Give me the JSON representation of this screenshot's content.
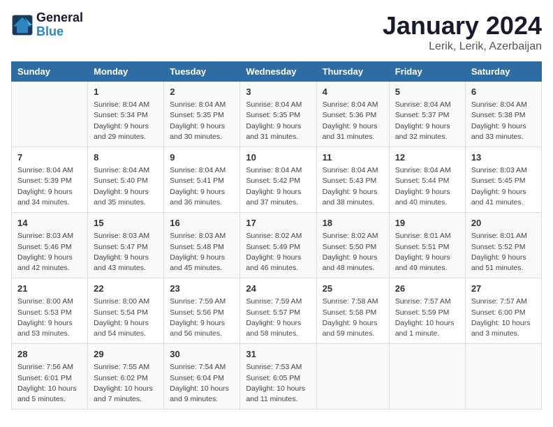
{
  "header": {
    "logo_line1": "General",
    "logo_line2": "Blue",
    "month": "January 2024",
    "location": "Lerik, Lerik, Azerbaijan"
  },
  "days": [
    "Sunday",
    "Monday",
    "Tuesday",
    "Wednesday",
    "Thursday",
    "Friday",
    "Saturday"
  ],
  "weeks": [
    [
      {
        "date": "",
        "text": ""
      },
      {
        "date": "1",
        "text": "Sunrise: 8:04 AM\nSunset: 5:34 PM\nDaylight: 9 hours\nand 29 minutes."
      },
      {
        "date": "2",
        "text": "Sunrise: 8:04 AM\nSunset: 5:35 PM\nDaylight: 9 hours\nand 30 minutes."
      },
      {
        "date": "3",
        "text": "Sunrise: 8:04 AM\nSunset: 5:35 PM\nDaylight: 9 hours\nand 31 minutes."
      },
      {
        "date": "4",
        "text": "Sunrise: 8:04 AM\nSunset: 5:36 PM\nDaylight: 9 hours\nand 31 minutes."
      },
      {
        "date": "5",
        "text": "Sunrise: 8:04 AM\nSunset: 5:37 PM\nDaylight: 9 hours\nand 32 minutes."
      },
      {
        "date": "6",
        "text": "Sunrise: 8:04 AM\nSunset: 5:38 PM\nDaylight: 9 hours\nand 33 minutes."
      }
    ],
    [
      {
        "date": "7",
        "text": "Sunrise: 8:04 AM\nSunset: 5:39 PM\nDaylight: 9 hours\nand 34 minutes."
      },
      {
        "date": "8",
        "text": "Sunrise: 8:04 AM\nSunset: 5:40 PM\nDaylight: 9 hours\nand 35 minutes."
      },
      {
        "date": "9",
        "text": "Sunrise: 8:04 AM\nSunset: 5:41 PM\nDaylight: 9 hours\nand 36 minutes."
      },
      {
        "date": "10",
        "text": "Sunrise: 8:04 AM\nSunset: 5:42 PM\nDaylight: 9 hours\nand 37 minutes."
      },
      {
        "date": "11",
        "text": "Sunrise: 8:04 AM\nSunset: 5:43 PM\nDaylight: 9 hours\nand 38 minutes."
      },
      {
        "date": "12",
        "text": "Sunrise: 8:04 AM\nSunset: 5:44 PM\nDaylight: 9 hours\nand 40 minutes."
      },
      {
        "date": "13",
        "text": "Sunrise: 8:03 AM\nSunset: 5:45 PM\nDaylight: 9 hours\nand 41 minutes."
      }
    ],
    [
      {
        "date": "14",
        "text": "Sunrise: 8:03 AM\nSunset: 5:46 PM\nDaylight: 9 hours\nand 42 minutes."
      },
      {
        "date": "15",
        "text": "Sunrise: 8:03 AM\nSunset: 5:47 PM\nDaylight: 9 hours\nand 43 minutes."
      },
      {
        "date": "16",
        "text": "Sunrise: 8:03 AM\nSunset: 5:48 PM\nDaylight: 9 hours\nand 45 minutes."
      },
      {
        "date": "17",
        "text": "Sunrise: 8:02 AM\nSunset: 5:49 PM\nDaylight: 9 hours\nand 46 minutes."
      },
      {
        "date": "18",
        "text": "Sunrise: 8:02 AM\nSunset: 5:50 PM\nDaylight: 9 hours\nand 48 minutes."
      },
      {
        "date": "19",
        "text": "Sunrise: 8:01 AM\nSunset: 5:51 PM\nDaylight: 9 hours\nand 49 minutes."
      },
      {
        "date": "20",
        "text": "Sunrise: 8:01 AM\nSunset: 5:52 PM\nDaylight: 9 hours\nand 51 minutes."
      }
    ],
    [
      {
        "date": "21",
        "text": "Sunrise: 8:00 AM\nSunset: 5:53 PM\nDaylight: 9 hours\nand 53 minutes."
      },
      {
        "date": "22",
        "text": "Sunrise: 8:00 AM\nSunset: 5:54 PM\nDaylight: 9 hours\nand 54 minutes."
      },
      {
        "date": "23",
        "text": "Sunrise: 7:59 AM\nSunset: 5:56 PM\nDaylight: 9 hours\nand 56 minutes."
      },
      {
        "date": "24",
        "text": "Sunrise: 7:59 AM\nSunset: 5:57 PM\nDaylight: 9 hours\nand 58 minutes."
      },
      {
        "date": "25",
        "text": "Sunrise: 7:58 AM\nSunset: 5:58 PM\nDaylight: 9 hours\nand 59 minutes."
      },
      {
        "date": "26",
        "text": "Sunrise: 7:57 AM\nSunset: 5:59 PM\nDaylight: 10 hours\nand 1 minute."
      },
      {
        "date": "27",
        "text": "Sunrise: 7:57 AM\nSunset: 6:00 PM\nDaylight: 10 hours\nand 3 minutes."
      }
    ],
    [
      {
        "date": "28",
        "text": "Sunrise: 7:56 AM\nSunset: 6:01 PM\nDaylight: 10 hours\nand 5 minutes."
      },
      {
        "date": "29",
        "text": "Sunrise: 7:55 AM\nSunset: 6:02 PM\nDaylight: 10 hours\nand 7 minutes."
      },
      {
        "date": "30",
        "text": "Sunrise: 7:54 AM\nSunset: 6:04 PM\nDaylight: 10 hours\nand 9 minutes."
      },
      {
        "date": "31",
        "text": "Sunrise: 7:53 AM\nSunset: 6:05 PM\nDaylight: 10 hours\nand 11 minutes."
      },
      {
        "date": "",
        "text": ""
      },
      {
        "date": "",
        "text": ""
      },
      {
        "date": "",
        "text": ""
      }
    ]
  ]
}
